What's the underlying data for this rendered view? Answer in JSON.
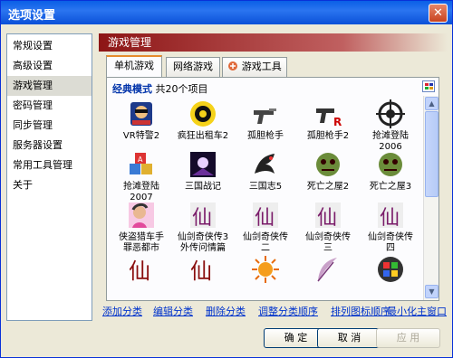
{
  "window": {
    "title": "选项设置"
  },
  "sidebar": {
    "items": [
      {
        "label": "常规设置"
      },
      {
        "label": "高级设置"
      },
      {
        "label": "游戏管理"
      },
      {
        "label": "密码管理"
      },
      {
        "label": "同步管理"
      },
      {
        "label": "服务器设置"
      },
      {
        "label": "常用工具管理"
      },
      {
        "label": "关于"
      }
    ],
    "selected": "游戏管理"
  },
  "panel": {
    "header": "游戏管理",
    "tabs": [
      {
        "label": "单机游戏"
      },
      {
        "label": "网络游戏"
      },
      {
        "label": "游戏工具"
      }
    ],
    "active_tab": "单机游戏",
    "mode_label": "经典模式",
    "item_count": "共20个项目",
    "games": [
      {
        "label": "VR特警2",
        "icon": "vr-cop-icon"
      },
      {
        "label": "疯狂出租车2",
        "icon": "taxi-icon"
      },
      {
        "label": "孤胆枪手",
        "icon": "pistol-icon"
      },
      {
        "label": "孤胆枪手2",
        "icon": "pistol-r-icon"
      },
      {
        "label": "抢滩登陆\n2006",
        "icon": "crosshair-icon"
      },
      {
        "label": "抢滩登陆\n2007",
        "icon": "blocks-icon"
      },
      {
        "label": "三国战记",
        "icon": "sanguo-icon"
      },
      {
        "label": "三国志5",
        "icon": "dragon-icon"
      },
      {
        "label": "死亡之屋2",
        "icon": "zombie-icon"
      },
      {
        "label": "死亡之屋3",
        "icon": "zombie-icon"
      },
      {
        "label": "侠盗猎车手\n罪恶都市",
        "icon": "gta-icon"
      },
      {
        "label": "仙剑奇侠传3\n外传问情篇",
        "icon": "xianjian-icon"
      },
      {
        "label": "仙剑奇侠传\n二",
        "icon": "xianjian-icon"
      },
      {
        "label": "仙剑奇侠传\n三",
        "icon": "xianjian-icon"
      },
      {
        "label": "仙剑奇侠传\n四",
        "icon": "xianjian-icon"
      },
      {
        "label": "",
        "icon": "xian-calligraphy-icon"
      },
      {
        "label": "",
        "icon": "xian-calligraphy-icon"
      },
      {
        "label": "",
        "icon": "sun-icon"
      },
      {
        "label": "",
        "icon": "feather-icon"
      },
      {
        "label": "",
        "icon": "windows-icon"
      }
    ],
    "links": [
      {
        "label": "添加分类"
      },
      {
        "label": "编辑分类"
      },
      {
        "label": "删除分类"
      },
      {
        "label": "调整分类顺序"
      },
      {
        "label": "排列图标顺序"
      },
      {
        "label": "最小化主窗口"
      }
    ]
  },
  "buttons": {
    "ok": "确 定",
    "cancel": "取 消",
    "apply": "应 用"
  },
  "colors": {
    "title_bar": "#0a5fe6",
    "panel_header": "#8d1515",
    "link": "#0033cc",
    "mode_label": "#0033aa"
  }
}
